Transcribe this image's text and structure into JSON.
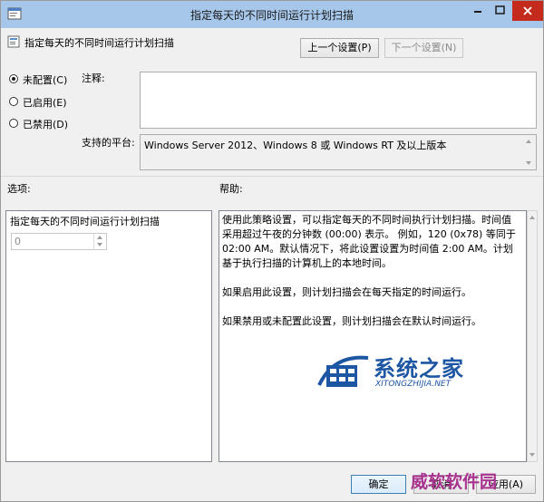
{
  "window": {
    "title": "指定每天的不同时间运行计划扫描"
  },
  "header": {
    "policy_name": "指定每天的不同时间运行计划扫描",
    "prev_button": "上一个设置(P)",
    "next_button": "下一个设置(N)"
  },
  "state_options": [
    {
      "label": "未配置(C)",
      "selected": true
    },
    {
      "label": "已启用(E)",
      "selected": false
    },
    {
      "label": "已禁用(D)",
      "selected": false
    }
  ],
  "comment": {
    "label": "注释:",
    "value": ""
  },
  "platform": {
    "label": "支持的平台:",
    "value": "Windows Server 2012、Windows 8 或 Windows RT 及以上版本"
  },
  "options": {
    "heading": "选项:",
    "field_label": "指定每天的不同时间运行计划扫描",
    "spinner_value": "0"
  },
  "help": {
    "heading": "帮助:",
    "paragraphs": [
      "使用此策略设置，可以指定每天的不同时间执行计划扫描。时间值采用超过午夜的分钟数 (00:00) 表示。 例如，120 (0x78) 等同于 02:00 AM。默认情况下，将此设置设置为时间值 2:00 AM。计划基于执行扫描的计算机上的本地时间。",
      "如果启用此设置，则计划扫描会在每天指定的时间运行。",
      "如果禁用或未配置此设置，则计划扫描会在默认时间运行。"
    ]
  },
  "footer": {
    "ok_button": "确定",
    "cancel_button": "取消",
    "apply_button": "应用(A)"
  },
  "watermark": {
    "title": "系统之家",
    "url": "XITONGZHIJIA.NET",
    "corner": "威软软件园"
  },
  "colors": {
    "titlebar": "#a6c7ea",
    "close_button": "#c42b1c",
    "window_bg": "#f0f0f0",
    "watermark_blue": "#1d56a3",
    "stamp_purple": "#a8338f"
  }
}
